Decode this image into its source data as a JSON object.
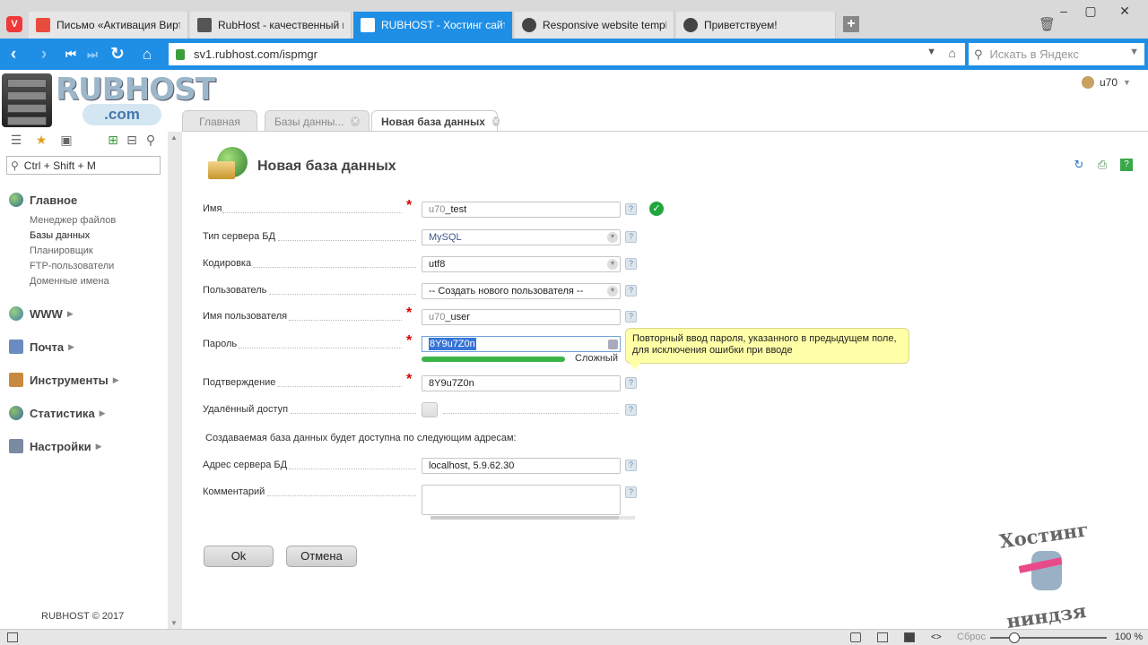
{
  "browser": {
    "tabs": [
      {
        "label": "Письмо «Активация Виртуа",
        "favicon": "#e74c3c"
      },
      {
        "label": "RubHost - качественный и",
        "favicon": "#555555"
      },
      {
        "label": "RUBHOST - Хостинг сайтов",
        "favicon": "#ffffff"
      },
      {
        "label": "Responsive website template",
        "favicon": "#444444"
      },
      {
        "label": "Приветствуем!",
        "favicon": "#444444"
      }
    ],
    "url": "sv1.rubhost.com/ispmgr",
    "search_placeholder": "Искать в Яндекс",
    "accent": "#1f8fe6"
  },
  "logo": {
    "word": "RUBHOST",
    "sub": ".com"
  },
  "sidebar": {
    "search_placeholder": "Ctrl + Shift + M",
    "groups": [
      {
        "label": "Главное",
        "items": [
          "Менеджер файлов",
          "Базы данных",
          "Планировщик",
          "FTP-пользователи",
          "Доменные имена"
        ]
      },
      {
        "label": "WWW"
      },
      {
        "label": "Почта"
      },
      {
        "label": "Инструменты"
      },
      {
        "label": "Статистика"
      },
      {
        "label": "Настройки"
      }
    ],
    "footer": "RUBHOST © 2017"
  },
  "user": {
    "name": "u70"
  },
  "page_tabs": [
    {
      "label": "Главная"
    },
    {
      "label": "Базы данны..."
    },
    {
      "label": "Новая база данных"
    }
  ],
  "form": {
    "title": "Новая база данных",
    "fields": {
      "name": {
        "label": "Имя",
        "prefix": "u70",
        "value": "_test"
      },
      "server_type": {
        "label": "Тип сервера БД",
        "value": "MySQL"
      },
      "encoding": {
        "label": "Кодировка",
        "value": "utf8"
      },
      "user": {
        "label": "Пользователь",
        "value": "-- Создать нового пользователя --"
      },
      "username": {
        "label": "Имя пользователя",
        "prefix": "u70",
        "value": "_user"
      },
      "password": {
        "label": "Пароль",
        "value": "8Y9u7Z0n",
        "strength": "Сложный"
      },
      "confirm": {
        "label": "Подтверждение",
        "value": "8Y9u7Z0n"
      },
      "remote": {
        "label": "Удалённый доступ"
      },
      "address": {
        "label": "Адрес сервера БД",
        "value": "localhost, 5.9.62.30"
      },
      "comment": {
        "label": "Комментарий",
        "value": ""
      }
    },
    "info": "Создаваемая база данных будет доступна по следующим адресам:",
    "tooltip": {
      "line1": "Повторный ввод пароля, указанного в предыдущем поле,",
      "line2": "для исключения ошибки при вводе"
    },
    "ok_label": "Ok",
    "cancel_label": "Отмена"
  },
  "mascot": {
    "word1": "Хостинг",
    "word2": "ниндзя"
  },
  "status": {
    "zoom_label": "Сброс",
    "zoom_value": "100 %"
  }
}
